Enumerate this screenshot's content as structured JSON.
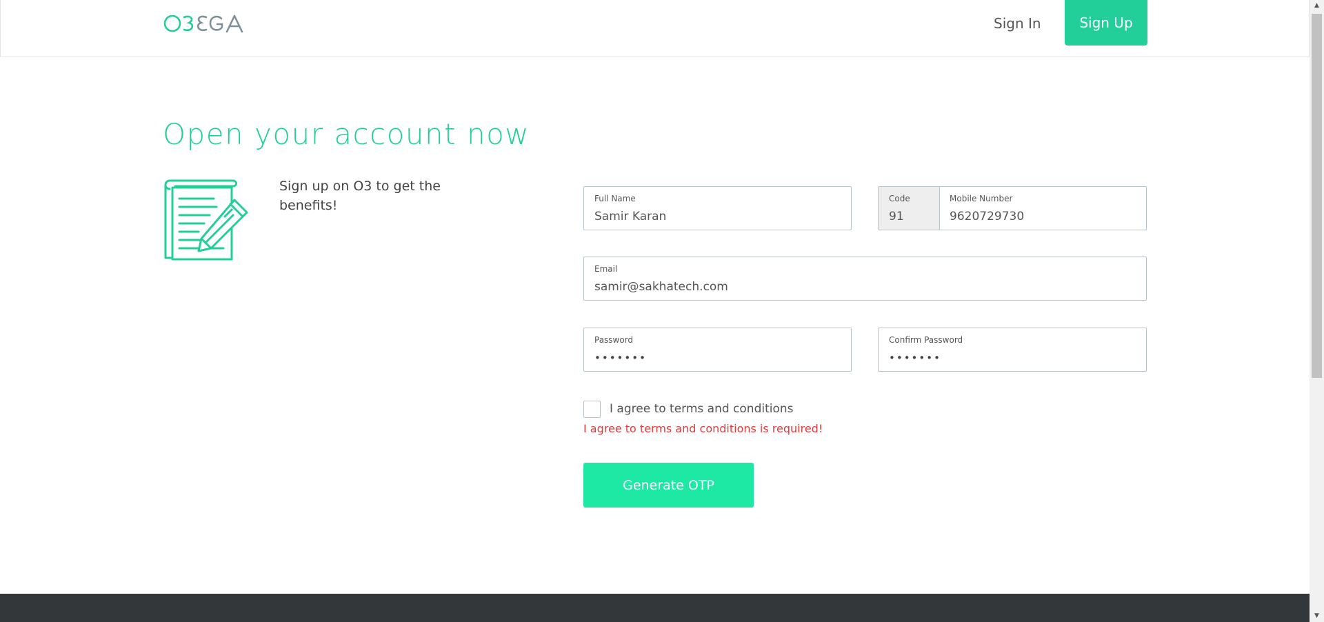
{
  "header": {
    "logo_text": "O3EGA",
    "signin_label": "Sign In",
    "signup_label": "Sign Up"
  },
  "main": {
    "title": "Open your account now",
    "benefits_text": "Sign up on O3 to get the benefits!",
    "form": {
      "full_name": {
        "label": "Full Name",
        "value": "Samir Karan"
      },
      "code": {
        "label": "Code",
        "value": "91"
      },
      "mobile": {
        "label": "Mobile Number",
        "value": "9620729730"
      },
      "email": {
        "label": "Email",
        "value": "samir@sakhatech.com"
      },
      "password": {
        "label": "Password",
        "value": "•••••••"
      },
      "confirm_password": {
        "label": "Confirm Password",
        "value": "•••••••"
      },
      "terms_label": "I agree to terms and conditions",
      "terms_error": "I agree to terms and conditions is required!",
      "generate_otp_label": "Generate OTP"
    }
  },
  "colors": {
    "accent": "#22cf98",
    "button_bright": "#1de9a5",
    "error": "#e33b3b",
    "footer": "#33373a"
  },
  "scrollbar": {
    "up_icon": "▲",
    "down_icon": "▼"
  }
}
